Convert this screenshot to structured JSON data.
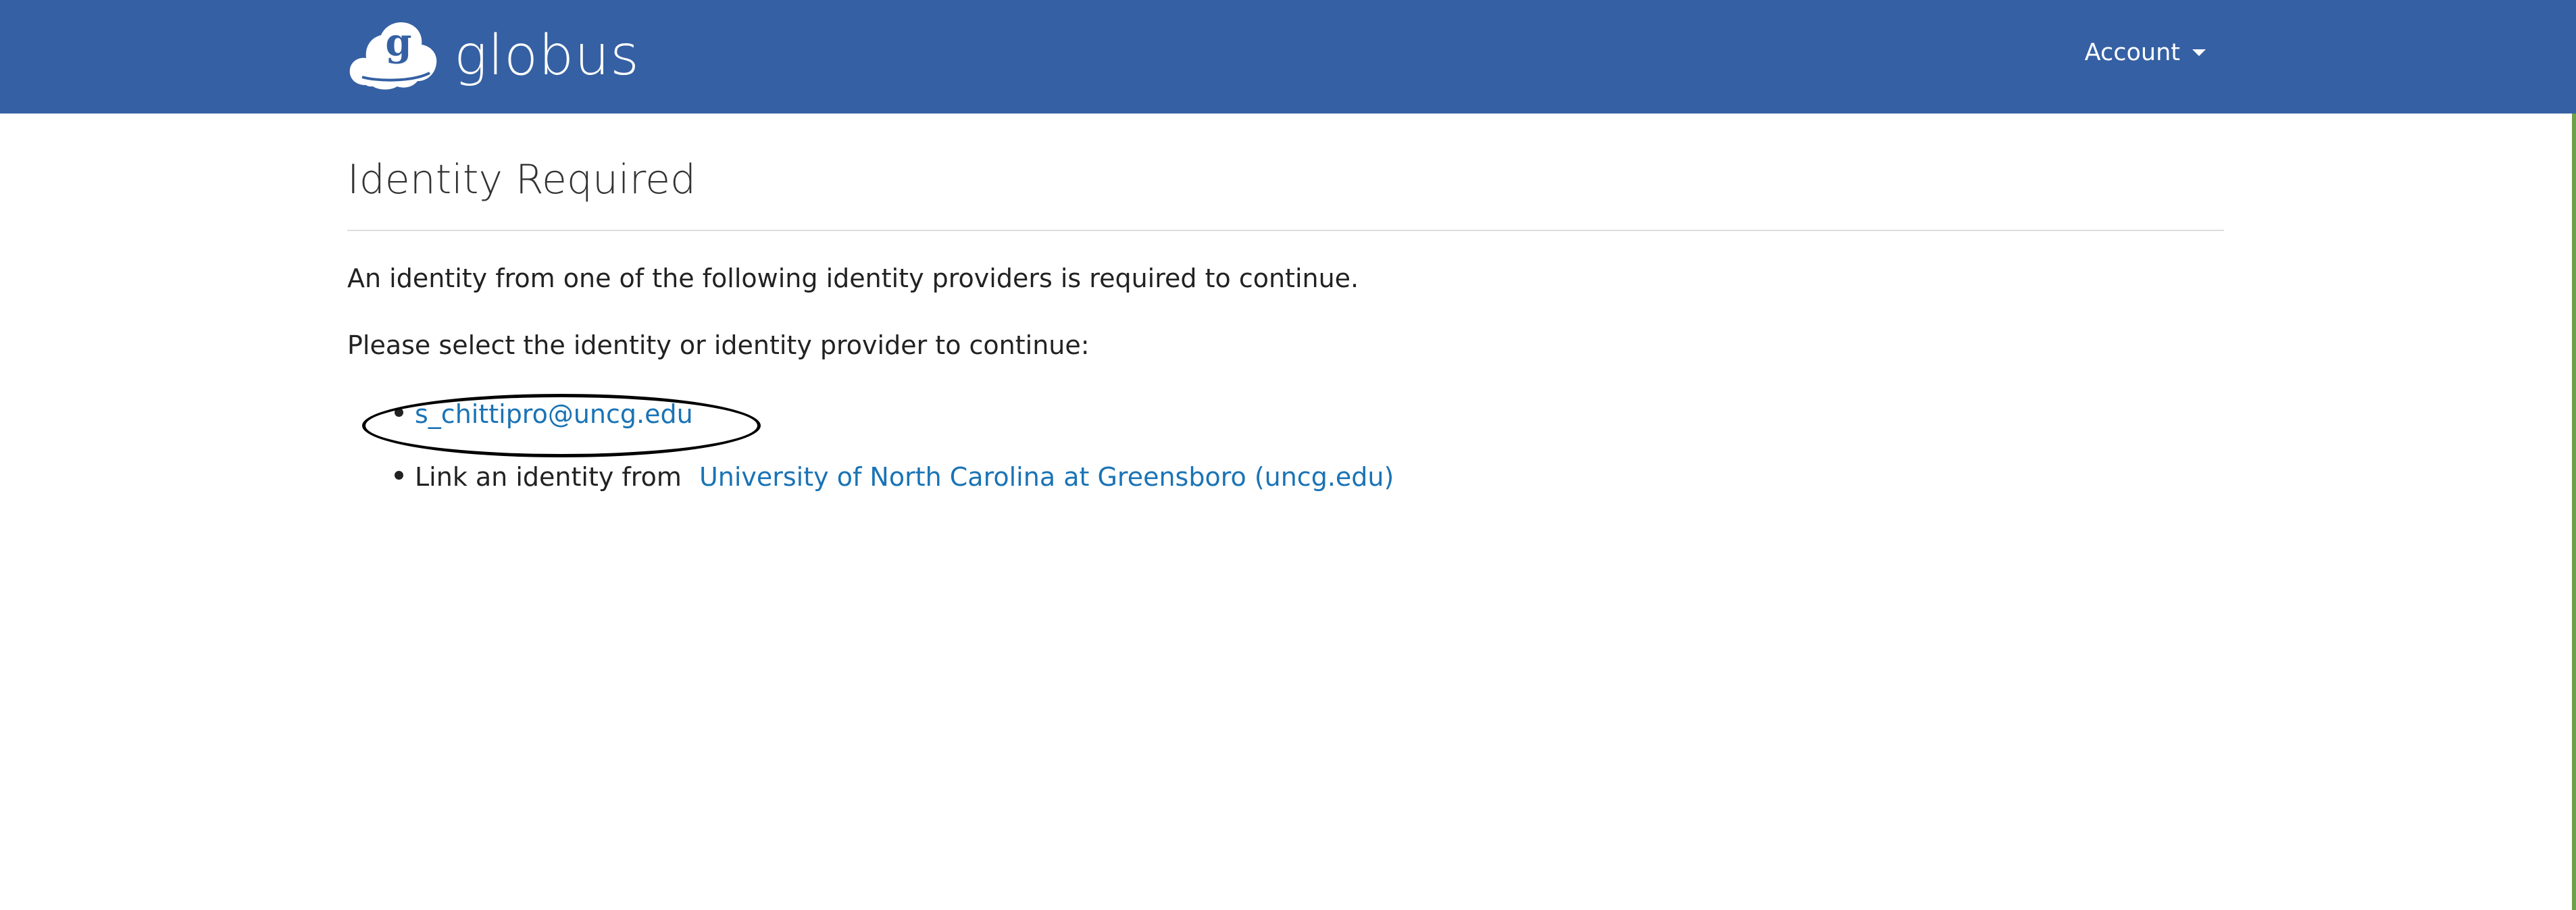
{
  "header": {
    "brand_name": "globus",
    "logo_letter": "g",
    "account_label": "Account",
    "background_color": "#3560a3"
  },
  "main": {
    "title": "Identity Required",
    "intro_text": "An identity from one of the following identity providers is required to continue.",
    "select_text": "Please select the identity or identity provider to continue:",
    "identities": [
      {
        "link_text": "s_chittipro@uncg.edu"
      },
      {
        "prefix": "Link an identity from",
        "link_text": "University of North Carolina at Greensboro (uncg.edu)"
      }
    ],
    "link_color": "#1a73b5"
  }
}
